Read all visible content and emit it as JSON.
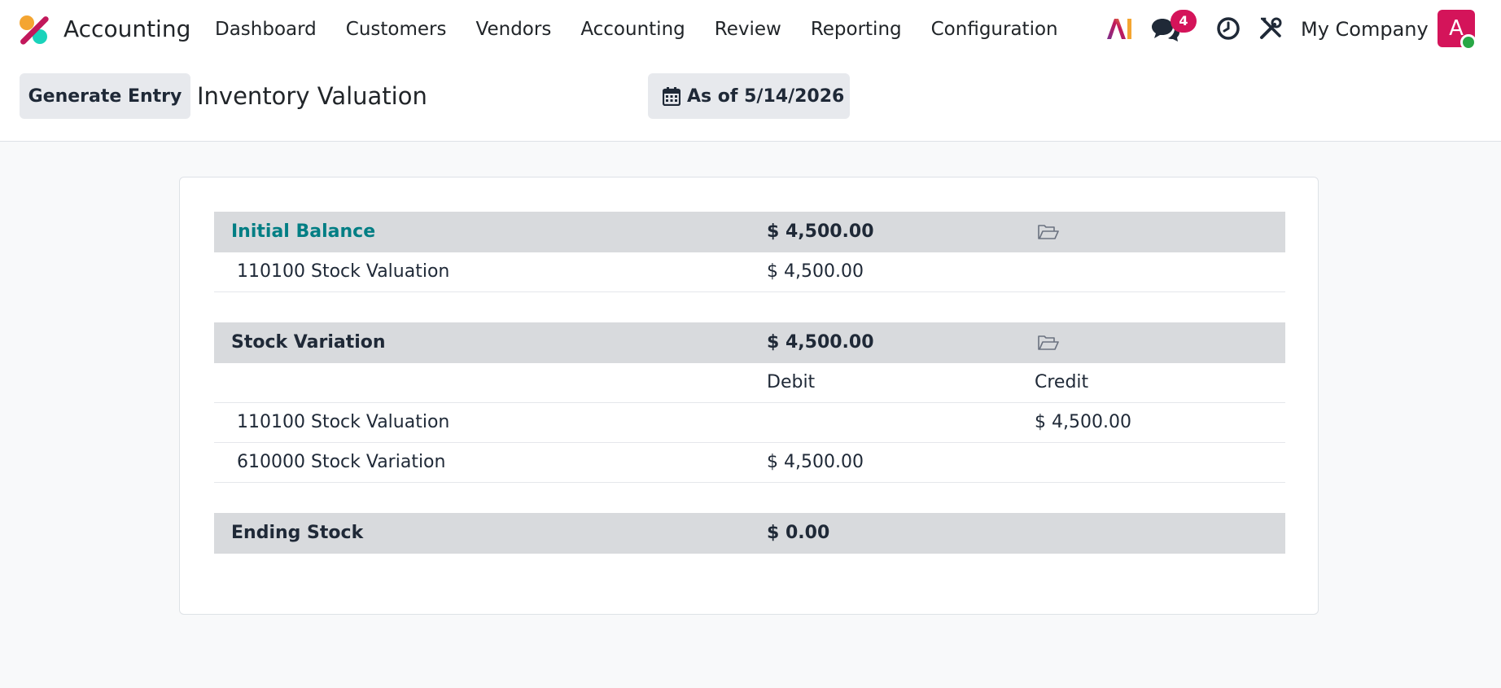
{
  "app": {
    "name": "Accounting"
  },
  "menu": [
    {
      "label": "Dashboard"
    },
    {
      "label": "Customers"
    },
    {
      "label": "Vendors"
    },
    {
      "label": "Accounting"
    },
    {
      "label": "Review"
    },
    {
      "label": "Reporting"
    },
    {
      "label": "Configuration"
    }
  ],
  "systray": {
    "chat_badge": "4",
    "company": "My Company",
    "avatar_letter": "A",
    "icons": [
      "ai-icon",
      "chat-icon",
      "clock-icon",
      "tools-icon"
    ]
  },
  "control_panel": {
    "generate_button": "Generate Entry",
    "title": "Inventory Valuation",
    "date_button": "As of 5/14/2026"
  },
  "report": {
    "initial_balance": {
      "label": "Initial Balance",
      "total": "$ 4,500.00",
      "lines": [
        {
          "account": "110100 Stock Valuation",
          "amount": "$ 4,500.00"
        }
      ]
    },
    "stock_variation": {
      "label": "Stock Variation",
      "total": "$ 4,500.00",
      "debit_label": "Debit",
      "credit_label": "Credit",
      "lines": [
        {
          "account": "110100 Stock Valuation",
          "debit": "",
          "credit": "$ 4,500.00"
        },
        {
          "account": "610000 Stock Variation",
          "debit": "$ 4,500.00",
          "credit": ""
        }
      ]
    },
    "ending_stock": {
      "label": "Ending Stock",
      "total": "$ 0.00"
    }
  },
  "colors": {
    "brand_pink": "#d4145a",
    "link_teal": "#017e84",
    "section_bg": "#d8dadd",
    "button_bg": "#e7e9ed"
  }
}
